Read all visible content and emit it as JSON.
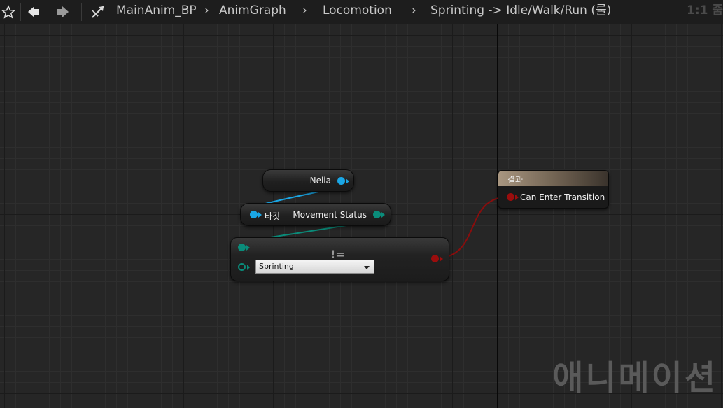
{
  "breadcrumb": [
    "MainAnim_BP",
    "AnimGraph",
    "Locomotion",
    "Sprinting -> Idle/Walk/Run (룰)"
  ],
  "zoom_label": "1:1 줌",
  "nodes": {
    "nelia": {
      "output_label": "Nelia"
    },
    "movement_status": {
      "input_label": "타깃",
      "output_label": "Movement Status"
    },
    "not_equal": {
      "operator": "!=",
      "enum_value": "Sprinting"
    },
    "result": {
      "title": "결과",
      "input_label": "Can Enter Transition"
    }
  },
  "watermark": "애니메이션",
  "colors": {
    "object_pin": "#1aa7e6",
    "enum_pin": "#0a8c7a",
    "bool_pin": "#9a0d0d",
    "result_header": "#a89680"
  }
}
